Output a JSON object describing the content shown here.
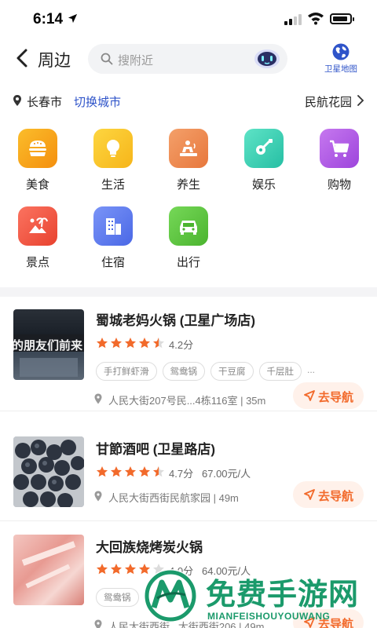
{
  "status_bar": {
    "time": "6:14"
  },
  "header": {
    "back_icon": "chevron-left-icon",
    "title": "周边",
    "search_placeholder": "搜附近",
    "map_label": "卫星地图",
    "accent": "#2f54c9"
  },
  "location": {
    "city": "长春市",
    "switch_label": "切换城市",
    "area": "民航花园"
  },
  "categories": [
    {
      "label": "美食",
      "icon": "burger-icon",
      "color": "#f7a51c"
    },
    {
      "label": "生活",
      "icon": "bulb-icon",
      "color": "#f9c52b"
    },
    {
      "label": "养生",
      "icon": "spa-icon",
      "color": "#ee8e52"
    },
    {
      "label": "娱乐",
      "icon": "guitar-icon",
      "color": "#3dcfb6"
    },
    {
      "label": "购物",
      "icon": "cart-icon",
      "color": "#b45ce6"
    },
    {
      "label": "景点",
      "icon": "palm-icon",
      "color": "#f25b4a"
    },
    {
      "label": "住宿",
      "icon": "building-icon",
      "color": "#5b7df2"
    },
    {
      "label": "出行",
      "icon": "car-icon",
      "color": "#5cc840"
    }
  ],
  "places": [
    {
      "name": "蜀城老妈火锅 (卫星广场店)",
      "rating": "4.2分",
      "stars": 4.5,
      "price": "",
      "tags": [
        "手打鲜虾滑",
        "鸳鸯锅",
        "干豆腐",
        "千层肚"
      ],
      "more": "...",
      "address": "人民大街207号民...4栋116室 | 35m",
      "nav_label": "去导航",
      "thumb_text": "的朋友们前来"
    },
    {
      "name": "甘節酒吧 (卫星路店)",
      "rating": "4.7分",
      "stars": 4.5,
      "price": "67.00元/人",
      "tags": [],
      "more": "",
      "address": "人民大街西街民航家园 | 49m",
      "nav_label": "去导航",
      "thumb_text": ""
    },
    {
      "name": "大回族烧烤炭火锅",
      "rating": "4.0分",
      "stars": 4,
      "price": "64.00元/人",
      "tags": [
        "鸳鸯锅"
      ],
      "more": "",
      "address": "人民大街西街...大街西街206 | 49m",
      "nav_label": "去导航",
      "thumb_text": ""
    }
  ],
  "watermark": {
    "title": "免费手游网",
    "subtitle": "MIANFEISHOUYOUWANG"
  },
  "colors": {
    "star": "#f26a2b",
    "nav_bg": "#fff1ea",
    "nav_text": "#f26a2b",
    "watermark": "#1b9a6b"
  }
}
